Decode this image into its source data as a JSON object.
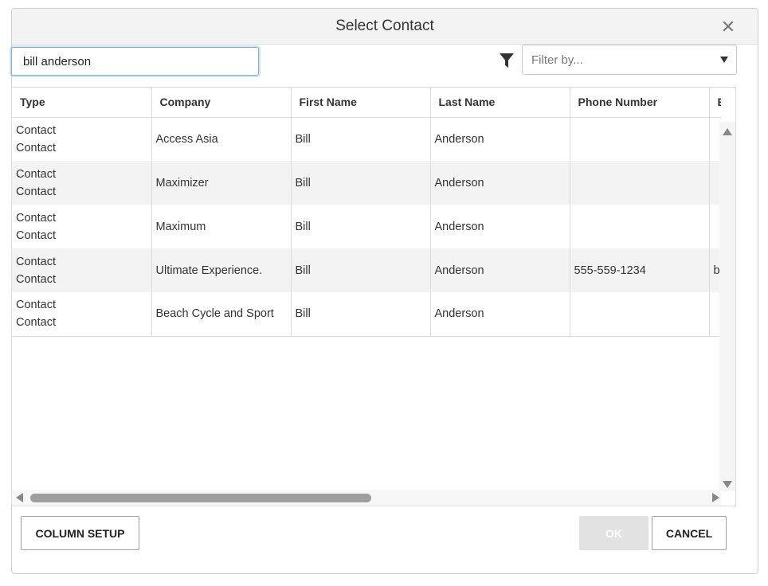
{
  "dialog": {
    "title": "Select Contact",
    "close_icon": "close-icon"
  },
  "search": {
    "value": "bill anderson"
  },
  "filter": {
    "placeholder": "Filter by...",
    "icon": "funnel-icon"
  },
  "grid": {
    "columns": [
      "Type",
      "Company",
      "First Name",
      "Last Name",
      "Phone Number",
      "E"
    ],
    "rows": [
      {
        "type": [
          "Contact",
          "Contact"
        ],
        "company": "Access Asia",
        "first": "Bill",
        "last": "Anderson",
        "phone": "",
        "extra": ""
      },
      {
        "type": [
          "Contact",
          "Contact"
        ],
        "company": "Maximizer",
        "first": "Bill",
        "last": "Anderson",
        "phone": "",
        "extra": ""
      },
      {
        "type": [
          "Contact",
          "Contact"
        ],
        "company": "Maximum",
        "first": "Bill",
        "last": "Anderson",
        "phone": "",
        "extra": ""
      },
      {
        "type": [
          "Contact",
          "Contact"
        ],
        "company": "Ultimate Experience.",
        "first": "Bill",
        "last": "Anderson",
        "phone": "555-559-1234",
        "extra": "b"
      },
      {
        "type": [
          "Contact",
          "Contact"
        ],
        "company": "Beach Cycle and Sport",
        "first": "Bill",
        "last": "Anderson",
        "phone": "",
        "extra": ""
      }
    ]
  },
  "footer": {
    "column_setup_label": "COLUMN SETUP",
    "ok_label": "OK",
    "cancel_label": "CANCEL"
  },
  "colors": {
    "header_bg": "#f3f3f3",
    "alt_row_bg": "#f3f3f3",
    "input_focus": "#7fb2d1",
    "ok_disabled_bg": "#e2e2e2"
  }
}
